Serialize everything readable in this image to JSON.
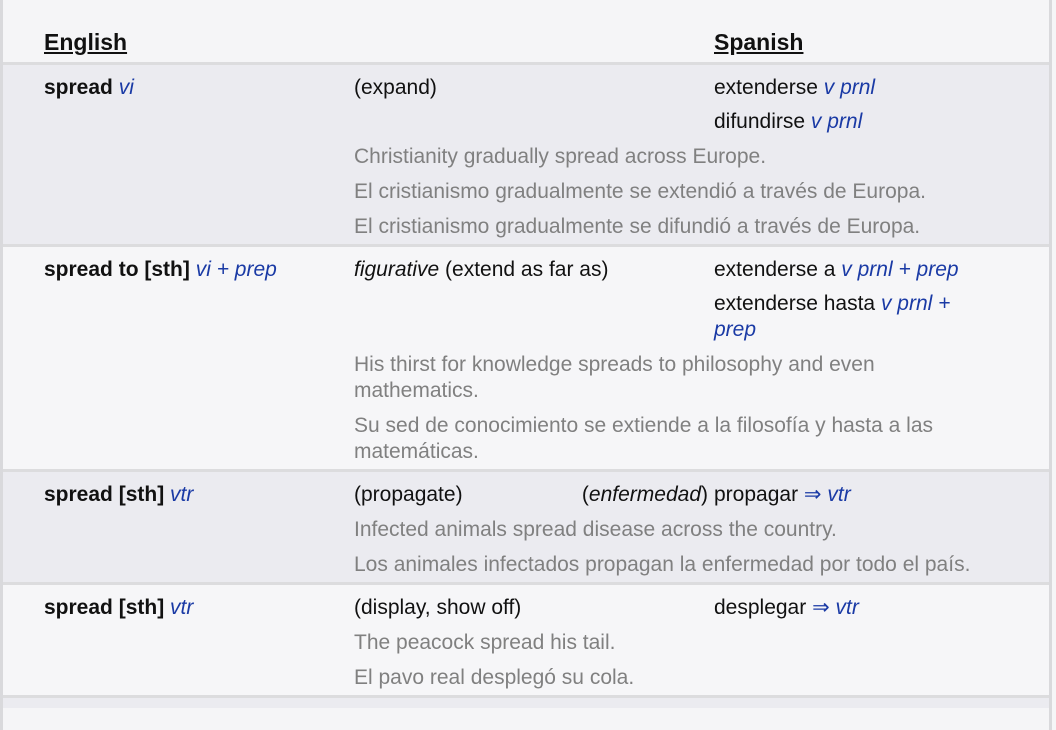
{
  "header": {
    "english": "English",
    "spanish": "Spanish"
  },
  "entries": [
    {
      "term": "spread",
      "pos": "vi",
      "sense": "(expand)",
      "sense_label": "",
      "translations": [
        {
          "word": "extenderse",
          "pos": "v prnl"
        },
        {
          "word": "difundirse",
          "pos": "v prnl"
        }
      ],
      "examples": [
        "Christianity gradually spread across Europe.",
        "El cristianismo gradualmente se extendió a través de Europa.",
        "El cristianismo gradualmente se difundió a través de Europa."
      ]
    },
    {
      "term": "spread to [sth]",
      "pos": "vi + prep",
      "sense_label": "figurative",
      "sense": " (extend as far as)",
      "translations": [
        {
          "word": "extenderse a",
          "pos": "v prnl + prep"
        },
        {
          "word": "extenderse hasta",
          "pos": "v prnl + prep"
        }
      ],
      "examples": [
        "His thirst for knowledge spreads to philosophy and even mathematics.",
        "Su sed de conocimiento se extiende a la filosofía y hasta a las matemáticas."
      ]
    },
    {
      "term": "spread [sth]",
      "pos": "vtr",
      "sense": "(propagate)",
      "context": "enfermedad",
      "translations": [
        {
          "word": "propagar",
          "arrow": "⇒",
          "pos": "vtr"
        }
      ],
      "examples": [
        "Infected animals spread disease across the country.",
        "Los animales infectados propagan la enfermedad por todo el país."
      ]
    },
    {
      "term": "spread [sth]",
      "pos": "vtr",
      "sense": "(display, show off)",
      "translations": [
        {
          "word": "desplegar",
          "arrow": "⇒",
          "pos": "vtr"
        }
      ],
      "examples": [
        "The peacock spread his tail.",
        "El pavo real desplegó su cola."
      ]
    }
  ],
  "colors": {
    "pos_blue": "#1a3aa5",
    "example_gray": "#808080",
    "row_dark": "#ebebf0",
    "row_light": "#f6f6f8"
  }
}
